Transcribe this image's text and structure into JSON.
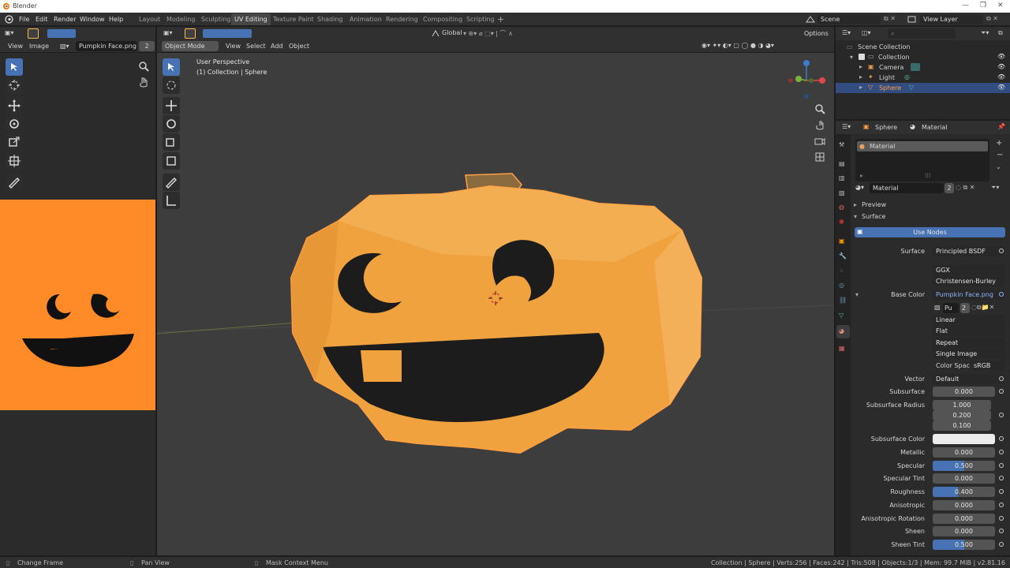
{
  "window": {
    "title": "Blender"
  },
  "menu": [
    "File",
    "Edit",
    "Render",
    "Window",
    "Help"
  ],
  "workspace_tabs": [
    "Layout",
    "Modeling",
    "Sculpting",
    "UV Editing",
    "Texture Paint",
    "Shading",
    "Animation",
    "Rendering",
    "Compositing",
    "Scripting"
  ],
  "active_workspace": "UV Editing",
  "top_right": {
    "scene": "Scene",
    "view_layer": "View Layer"
  },
  "uv_editor": {
    "menus": [
      "View",
      "Image"
    ],
    "image_name": "Pumpkin Face.png",
    "users": "2"
  },
  "viewport": {
    "mode": "Object Mode",
    "menus": [
      "View",
      "Select",
      "Add",
      "Object"
    ],
    "transform_orientation": "Global",
    "options": "Options",
    "overlay_title": "User Perspective",
    "overlay_sub": "(1) Collection | Sphere"
  },
  "outliner": {
    "root": "Scene Collection",
    "collection": "Collection",
    "items": [
      "Camera",
      "Light",
      "Sphere"
    ],
    "selected": "Sphere"
  },
  "properties": {
    "breadcrumb_object": "Sphere",
    "breadcrumb_material": "Material",
    "slot": "Material",
    "material_name": "Material",
    "material_users": "2",
    "panels": {
      "preview": "Preview",
      "surface": "Surface"
    },
    "use_nodes": "Use Nodes",
    "surface_label": "Surface",
    "surface_value": "Principled BSDF",
    "distribution": "GGX",
    "subsurface_method": "Christensen-Burley",
    "base_color_label": "Base Color",
    "base_color_value": "Pumpkin Face.png",
    "image_short": "Pu",
    "image_users": "2",
    "interpolation": "Linear",
    "projection": "Flat",
    "extension": "Repeat",
    "source": "Single Image",
    "color_space_label": "Color Spac",
    "color_space_value": "sRGB",
    "vector_label": "Vector",
    "vector_value": "Default",
    "subsurface_radius_label": "Subsurface Radius",
    "subsurface_radius": [
      "1.000",
      "0.200",
      "0.100"
    ],
    "subsurface_color_label": "Subsurface Color",
    "rows": [
      {
        "label": "Subsurface",
        "value": "0.000",
        "fill": 0
      },
      {
        "label": "Metallic",
        "value": "0.000",
        "fill": 0
      },
      {
        "label": "Specular",
        "value": "0.500",
        "fill": 0.5
      },
      {
        "label": "Specular Tint",
        "value": "0.000",
        "fill": 0
      },
      {
        "label": "Roughness",
        "value": "0.400",
        "fill": 0.4
      },
      {
        "label": "Anisotropic",
        "value": "0.000",
        "fill": 0
      },
      {
        "label": "Anisotropic Rotation",
        "value": "0.000",
        "fill": 0
      },
      {
        "label": "Sheen",
        "value": "0.000",
        "fill": 0
      },
      {
        "label": "Sheen Tint",
        "value": "0.500",
        "fill": 0.5
      }
    ]
  },
  "statusbar": {
    "left": "Change Frame",
    "mid": "Pan View",
    "right": "Mask Context Menu",
    "info": "Collection | Sphere | Verts:256 | Faces:242 | Tris:508 | Objects:1/3 | Mem: 99.7 MiB | v2.81.16"
  },
  "colors": {
    "pumpkin": "#f4a13f",
    "orange_bg": "#ff8a28",
    "accent": "#4772b3",
    "select": "#ffa040"
  }
}
